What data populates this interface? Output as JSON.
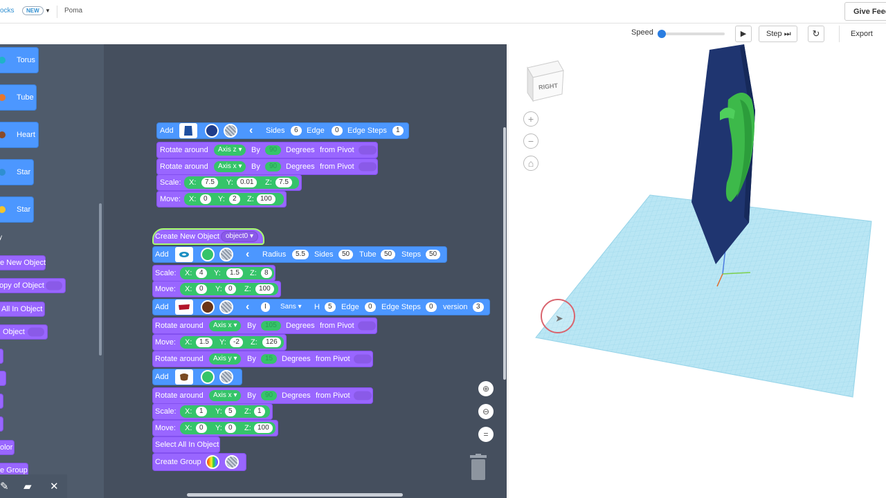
{
  "topbar": {
    "brand": "ocks",
    "new_badge": "NEW",
    "doc_title": "Poma",
    "feedback": "Give Feed"
  },
  "controls": {
    "speed_label": "Speed",
    "step_label": "Step",
    "export_label": "Export"
  },
  "palette": {
    "items": [
      {
        "label": "Torus",
        "color": "#4c97ff"
      },
      {
        "label": "Tube",
        "color": "#4c97ff"
      },
      {
        "label": "Heart",
        "color": "#4c97ff"
      },
      {
        "label": "Star",
        "color": "#4c97ff"
      },
      {
        "label": "Star",
        "color": "#4c97ff"
      }
    ],
    "section_text": "y",
    "object_blocks": [
      "e New Object",
      "opy of Object",
      "All In Object",
      "Object"
    ],
    "extra_blocks": [
      "olor",
      "e Group"
    ]
  },
  "blocks": {
    "add_polygon": {
      "add": "Add",
      "sides_label": "Sides",
      "sides": "6",
      "edge_label": "Edge",
      "edge": "0",
      "edge_steps_label": "Edge Steps",
      "edge_steps": "1"
    },
    "rot1": {
      "label": "Rotate around",
      "axis": "Axis z",
      "by": "By",
      "value": "90",
      "degrees": "Degrees",
      "from": "from Pivot"
    },
    "rot2": {
      "label": "Rotate around",
      "axis": "Axis x",
      "by": "By",
      "value": "90",
      "degrees": "Degrees",
      "from": "from Pivot"
    },
    "scale1": {
      "label": "Scale:",
      "x_label": "X:",
      "x": "7.5",
      "y_label": "Y:",
      "y": "0.01",
      "z_label": "Z:",
      "z": "7.5"
    },
    "move1": {
      "label": "Move:",
      "x_label": "X:",
      "x": "0",
      "y_label": "Y:",
      "y": "2",
      "z_label": "Z:",
      "z": "100"
    },
    "create": {
      "label": "Create New Object",
      "object": "object0"
    },
    "add_torus": {
      "add": "Add",
      "radius_label": "Radius",
      "radius": "5.5",
      "sides_label": "Sides",
      "sides": "50",
      "tube_label": "Tube",
      "tube": "50",
      "steps_label": "Steps",
      "steps": "50"
    },
    "scale2": {
      "label": "Scale:",
      "x_label": "X:",
      "x": "4",
      "y_label": "Y:",
      "y": "1.5",
      "z_label": "Z:",
      "z": "8"
    },
    "move2": {
      "label": "Move:",
      "x_label": "X:",
      "x": "0",
      "y_label": "Y:",
      "y": "0",
      "z_label": "Z:",
      "z": "100"
    },
    "add_text": {
      "add": "Add",
      "text": "I",
      "font": "Sans",
      "h_label": "H",
      "h": "5",
      "edge_label": "Edge",
      "edge": "0",
      "edge_steps_label": "Edge Steps",
      "edge_steps": "0",
      "version_label": "version",
      "version": "3"
    },
    "rot3": {
      "label": "Rotate around",
      "axis": "Axis x",
      "by": "By",
      "value": "105",
      "degrees": "Degrees",
      "from": "from Pivot"
    },
    "move3": {
      "label": "Move:",
      "x_label": "X:",
      "x": "1.5",
      "y_label": "Y:",
      "y": "-2",
      "z_label": "Z:",
      "z": "126"
    },
    "rot4": {
      "label": "Rotate around",
      "axis": "Axis y",
      "by": "By",
      "value": "15",
      "degrees": "Degrees",
      "from": "from Pivot"
    },
    "add_heart": {
      "add": "Add"
    },
    "rot5": {
      "label": "Rotate around",
      "axis": "Axis x",
      "by": "By",
      "value": "90",
      "degrees": "Degrees",
      "from": "from Pivot"
    },
    "scale3": {
      "label": "Scale:",
      "x_label": "X:",
      "x": "1",
      "y_label": "Y:",
      "y": "5",
      "z_label": "Z:",
      "z": "1"
    },
    "move4": {
      "label": "Move:",
      "x_label": "X:",
      "x": "0",
      "y_label": "Y:",
      "y": "0",
      "z_label": "Z:",
      "z": "100"
    },
    "select_all": {
      "label": "Select All In Object"
    },
    "create_group": {
      "label": "Create Group"
    }
  },
  "viewport": {
    "cube_face": "RIGHT"
  },
  "colors": {
    "block_blue": "#4c97ff",
    "block_purple": "#9966ff",
    "block_green": "#36c46a",
    "workspace": "#454f5e",
    "grid": "#a9dff0"
  }
}
